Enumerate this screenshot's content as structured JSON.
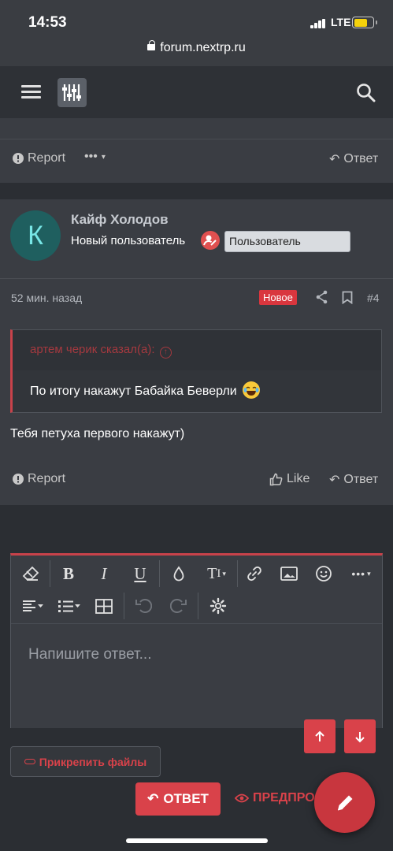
{
  "status": {
    "time": "14:53",
    "network": "LTE",
    "url": "forum.nextrp.ru"
  },
  "post_top": {
    "report": "Report",
    "more": "•••",
    "reply": "Ответ"
  },
  "post": {
    "avatar_letter": "К",
    "username": "Кайф Холодов",
    "user_title": "Новый пользователь",
    "user_role": "Пользователь",
    "time_ago": "52 мин. назад",
    "new_badge": "Новое",
    "post_number": "#4",
    "quote_author": "артем черик сказал(а):",
    "quote_text": "По итогу накажут Бабайка Беверли",
    "message": "Тебя петуха первого накажут)",
    "report": "Report",
    "like": "Like",
    "reply": "Ответ"
  },
  "editor": {
    "placeholder": "Напишите ответ...",
    "attach": "Прикрепить файлы",
    "submit": "ОТВЕТ",
    "preview": "ПРЕДПРО"
  },
  "colors": {
    "accent": "#d9424a",
    "background": "#2b2e33",
    "card": "#3a3d43"
  }
}
